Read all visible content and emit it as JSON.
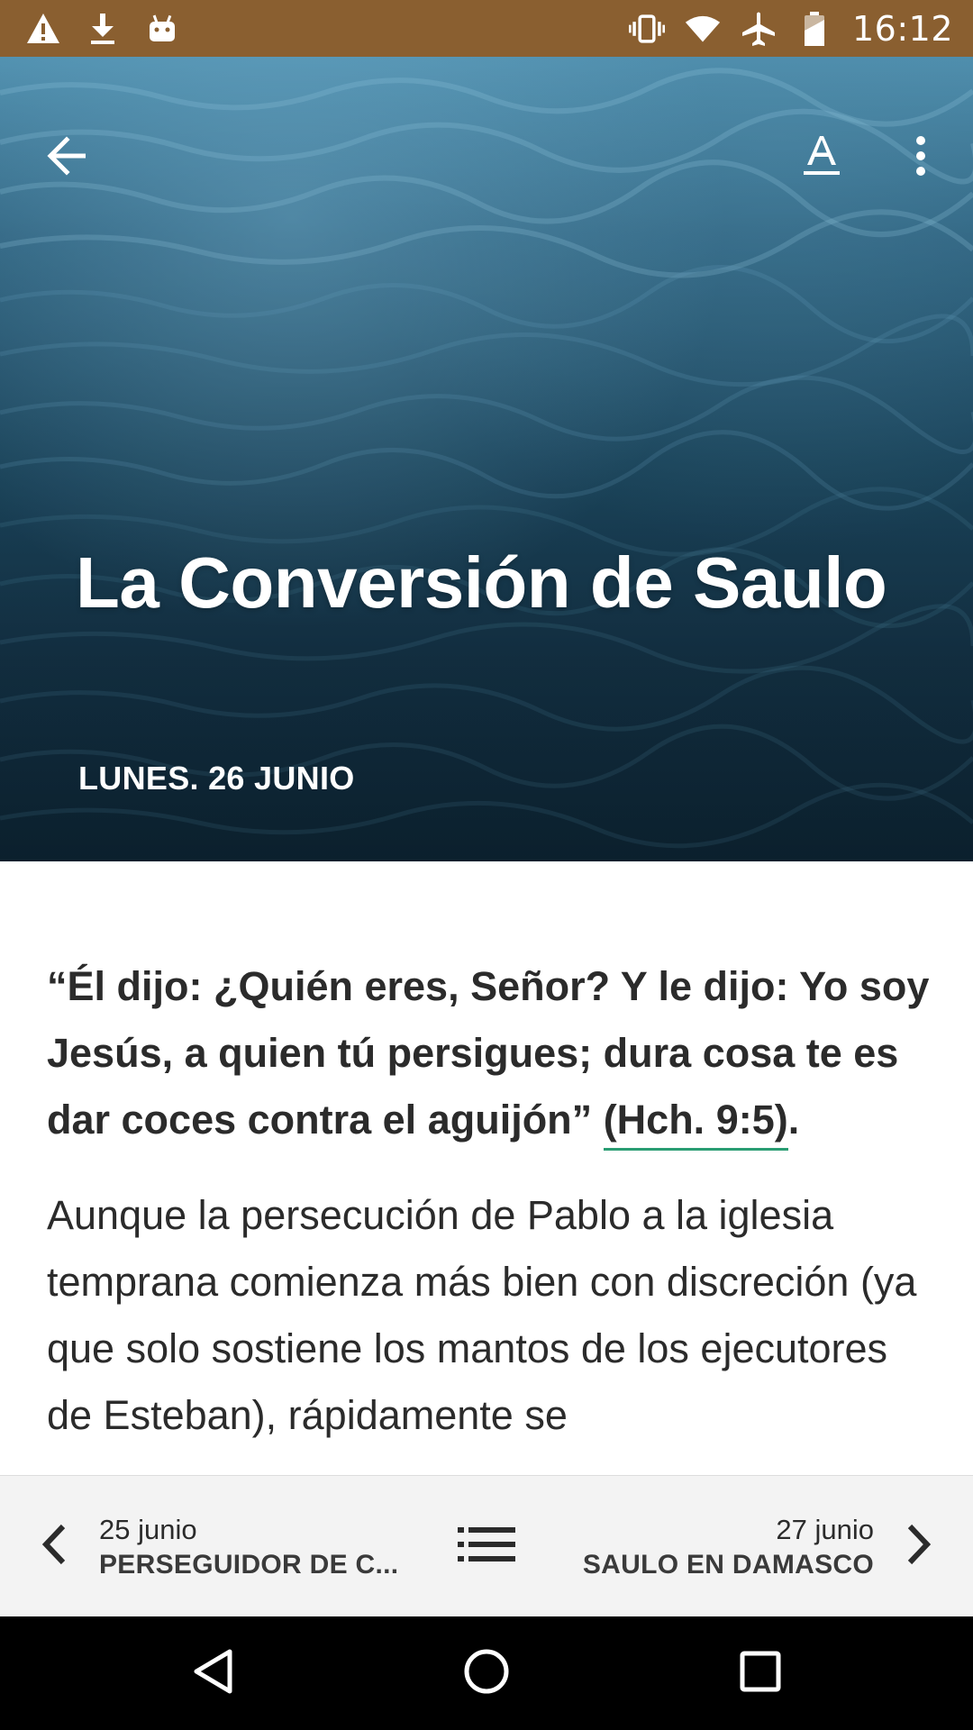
{
  "status_bar": {
    "time": "16:12",
    "left_icons": [
      "warning-icon",
      "download-icon",
      "android-icon"
    ],
    "right_icons": [
      "vibrate-icon",
      "wifi-icon",
      "airplane-icon",
      "battery-icon"
    ]
  },
  "header": {
    "back_icon": "arrow-back-icon",
    "text_size_icon": "text-format-icon",
    "menu_icon": "more-vert-icon",
    "title": "La Conversión de Saulo",
    "date": "LUNES. 26 JUNIO"
  },
  "content": {
    "quote_text": "“Él dijo: ¿Quién eres, Señor? Y le dijo: Yo soy Jesús, a quien tú persigues; dura cosa te es dar coces contra el aguijón” ",
    "quote_reference": "(Hch. 9:5)",
    "quote_end": ".",
    "paragraph": "Aunque la persecución de Pablo a la iglesia temprana comienza más bien con discreción (ya que solo sostiene los mantos de los ejecutores de Esteban), rápidamente se"
  },
  "bottom_nav": {
    "prev": {
      "date": "25 junio",
      "title": "PERSEGUIDOR DE C..."
    },
    "next": {
      "date": "27 junio",
      "title": "SAULO EN DAMASCO"
    },
    "list_icon": "list-icon"
  },
  "system_nav": [
    "back-triangle-icon",
    "home-circle-icon",
    "recents-square-icon"
  ],
  "colors": {
    "status_bar": "#8a5f30",
    "accent_underline": "#2a9d73",
    "body_text": "#2b2b2b",
    "bottom_nav_bg": "#f3f3f3"
  }
}
